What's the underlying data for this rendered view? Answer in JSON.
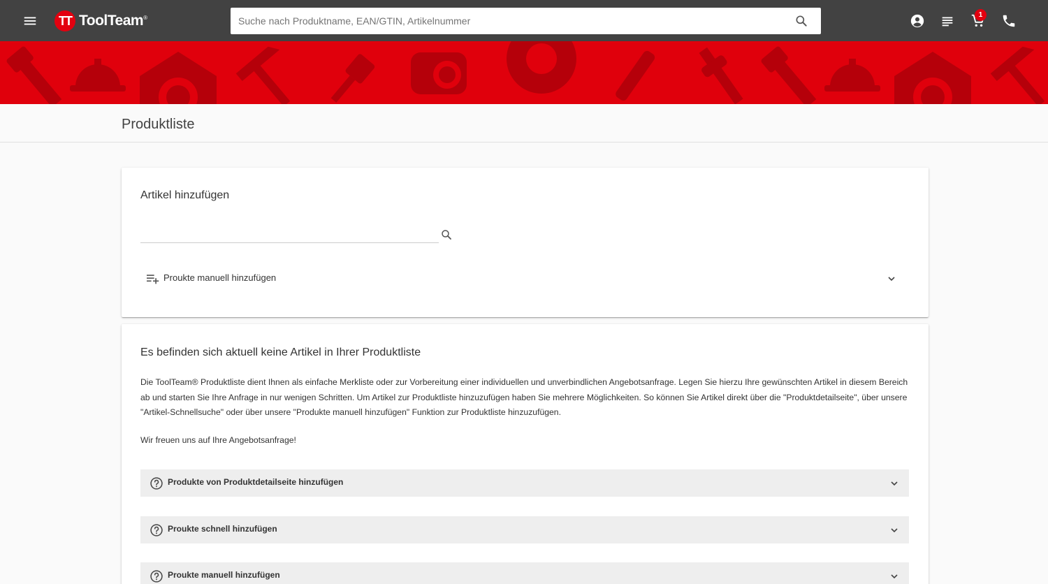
{
  "header": {
    "logo_mark": "TT",
    "logo_text": "ToolTeam",
    "logo_reg": "®",
    "search_placeholder": "Suche nach Produktname, EAN/GTIN, Artikelnummer",
    "cart_count": "1",
    "icons": [
      "menu-icon",
      "search-icon",
      "account-icon",
      "list-icon",
      "cart-icon",
      "phone-icon"
    ]
  },
  "colors": {
    "header_bg": "#424242",
    "brand_red": "#e3000f",
    "banner_red": "#e0000c",
    "banner_pattern": "#b5000a"
  },
  "page": {
    "title": "Produktliste"
  },
  "add_card": {
    "title": "Artikel hinzufügen",
    "input_value": "",
    "manual_add_label": "Proukte manuell hinzufügen"
  },
  "info_card": {
    "title": "Es befinden sich aktuell keine Artikel in Ihrer Produktliste",
    "description": "Die ToolTeam® Produktliste dient Ihnen als einfache Merkliste oder zur Vorbereitung einer individuellen und unverbindlichen Angebotsanfrage. Legen Sie hierzu Ihre gewünschten Artikel in diesem Bereich ab und starten Sie Ihre Anfrage in nur wenigen Schritten. Um Artikel zur Produktliste hinzuzufügen haben Sie mehrere Möglichkeiten. So können Sie Artikel direkt über die \"Produktdetailseite\", über unsere \"Artikel-Schnellsuche\" oder über unsere \"Produkte manuell hinzufügen\" Funktion zur Produktliste hinzuzufügen.",
    "thanks": "Wir freuen uns auf Ihre Angebotsanfrage!",
    "accordions": [
      {
        "label": "Produkte von Produktdetailseite hinzufügen"
      },
      {
        "label": "Proukte schnell hinzufügen"
      },
      {
        "label": "Proukte manuell hinzufügen"
      }
    ]
  }
}
